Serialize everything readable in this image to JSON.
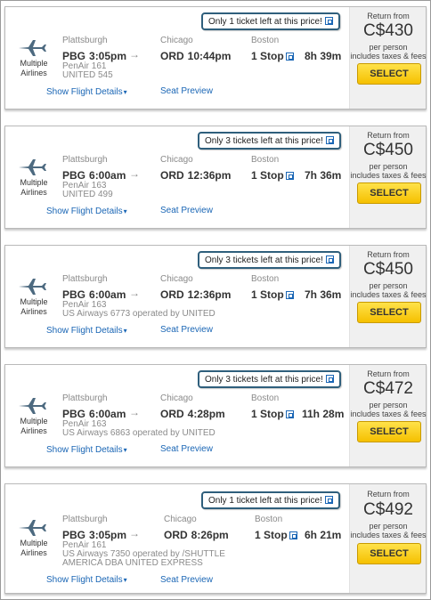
{
  "labels": {
    "multiple_airlines_1": "Multiple",
    "multiple_airlines_2": "Airlines",
    "show_details": "Show Flight Details",
    "seat_preview": "Seat Preview",
    "return_from": "Return from",
    "per_person": "per person",
    "includes": "includes taxes & fees",
    "select": "SELECT"
  },
  "results": [
    {
      "alert": "Only 1 ticket left at this price!",
      "origin_city": "Plattsburgh",
      "origin_code": "PBG",
      "depart": "3:05pm",
      "connect_city": "Chicago",
      "connect_code": "ORD",
      "arrive": "10:44pm",
      "dest_city": "Boston",
      "stops": "1 Stop",
      "duration": "8h 39m",
      "flight_line1": "PenAir 161",
      "flight_line2": "UNITED 545",
      "flight_line3": "",
      "price": "C$430"
    },
    {
      "alert": "Only 3 tickets left at this price!",
      "origin_city": "Plattsburgh",
      "origin_code": "PBG",
      "depart": "6:00am",
      "connect_city": "Chicago",
      "connect_code": "ORD",
      "arrive": "12:36pm",
      "dest_city": "Boston",
      "stops": "1 Stop",
      "duration": "7h 36m",
      "flight_line1": "PenAir 163",
      "flight_line2": "UNITED 499",
      "flight_line3": "",
      "price": "C$450"
    },
    {
      "alert": "Only 3 tickets left at this price!",
      "origin_city": "Plattsburgh",
      "origin_code": "PBG",
      "depart": "6:00am",
      "connect_city": "Chicago",
      "connect_code": "ORD",
      "arrive": "12:36pm",
      "dest_city": "Boston",
      "stops": "1 Stop",
      "duration": "7h 36m",
      "flight_line1": "PenAir 163",
      "flight_line2": "US Airways 6773 operated by UNITED",
      "flight_line3": "",
      "price": "C$450"
    },
    {
      "alert": "Only 3 tickets left at this price!",
      "origin_city": "Plattsburgh",
      "origin_code": "PBG",
      "depart": "6:00am",
      "connect_city": "Chicago",
      "connect_code": "ORD",
      "arrive": "4:28pm",
      "dest_city": "Boston",
      "stops": "1 Stop",
      "duration": "11h 28m",
      "flight_line1": "PenAir 163",
      "flight_line2": "US Airways 6863 operated by UNITED",
      "flight_line3": "",
      "price": "C$472"
    },
    {
      "alert": "Only 1 ticket left at this price!",
      "origin_city": "Plattsburgh",
      "origin_code": "PBG",
      "depart": "3:05pm",
      "connect_city": "Chicago",
      "connect_code": "ORD",
      "arrive": "8:26pm",
      "dest_city": "Boston",
      "stops": "1 Stop",
      "duration": "6h 21m",
      "flight_line1": "PenAir 161",
      "flight_line2": "US Airways 7350 operated by /SHUTTLE",
      "flight_line3": "AMERICA DBA UNITED EXPRESS",
      "price": "C$492"
    }
  ],
  "icons": {
    "plane": "airplane-icon",
    "arrow": "right-arrow-icon",
    "popup": "popup-window-icon",
    "chevron": "double-chevron-down-icon"
  },
  "colors": {
    "link": "#1a66b5",
    "select_button": "#f5c000",
    "alert_border": "#2f5f7c"
  }
}
